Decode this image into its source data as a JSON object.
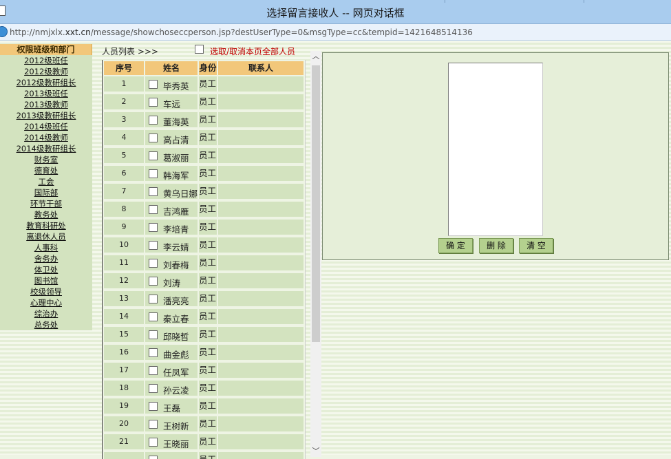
{
  "window": {
    "title": "选择留言接收人 -- 网页对话框",
    "url_prefix": "http://nmjxlx.",
    "url_domain": "xxt.cn",
    "url_path": "/message/showchoseccperson.jsp?destUserType=0&msgType=cc&tempid=1421648514136"
  },
  "departments": {
    "header": "权限班级和部门",
    "items": [
      "2012级班任",
      "2012级教师",
      "2012级教研组长",
      "2013级班任",
      "2013级教师",
      "2013级教研组长",
      "2014级班任",
      "2014级教师",
      "2014级教研组长",
      "财务室",
      "德育处",
      "工会",
      "国际部",
      "环节干部",
      "教务处",
      "教育科研处",
      "离退休人员",
      "人事科",
      "舍务办",
      "体卫处",
      "图书馆",
      "校级领导",
      "心理中心",
      "综治办",
      "总务处"
    ]
  },
  "people": {
    "caption": "人员列表 >>>",
    "select_all_label": "选取/取消本页全部人员",
    "columns": {
      "no": "序号",
      "name": "姓名",
      "role": "身份",
      "contact": "联系人"
    },
    "rows": [
      {
        "no": "1",
        "name": "毕秀英",
        "role": "员工"
      },
      {
        "no": "2",
        "name": "车远",
        "role": "员工"
      },
      {
        "no": "3",
        "name": "董海英",
        "role": "员工"
      },
      {
        "no": "4",
        "name": "高占清",
        "role": "员工"
      },
      {
        "no": "5",
        "name": "葛淑丽",
        "role": "员工"
      },
      {
        "no": "6",
        "name": "韩海军",
        "role": "员工"
      },
      {
        "no": "7",
        "name": "黄乌日娜",
        "role": "员工"
      },
      {
        "no": "8",
        "name": "吉鸿雁",
        "role": "员工"
      },
      {
        "no": "9",
        "name": "李培青",
        "role": "员工"
      },
      {
        "no": "10",
        "name": "李云婧",
        "role": "员工"
      },
      {
        "no": "11",
        "name": "刘春梅",
        "role": "员工"
      },
      {
        "no": "12",
        "name": "刘涛",
        "role": "员工"
      },
      {
        "no": "13",
        "name": "潘亮亮",
        "role": "员工"
      },
      {
        "no": "14",
        "name": "秦立春",
        "role": "员工"
      },
      {
        "no": "15",
        "name": "邱晓哲",
        "role": "员工"
      },
      {
        "no": "16",
        "name": "曲金彪",
        "role": "员工"
      },
      {
        "no": "17",
        "name": "任凤军",
        "role": "员工"
      },
      {
        "no": "18",
        "name": "孙云凌",
        "role": "员工"
      },
      {
        "no": "19",
        "name": "王磊",
        "role": "员工"
      },
      {
        "no": "20",
        "name": "王树新",
        "role": "员工"
      },
      {
        "no": "21",
        "name": "王晓丽",
        "role": "员工"
      },
      {
        "no": "",
        "name": "",
        "role": "员工"
      }
    ]
  },
  "actions": {
    "ok": "确 定",
    "delete": "删 除",
    "clear": "清 空"
  }
}
